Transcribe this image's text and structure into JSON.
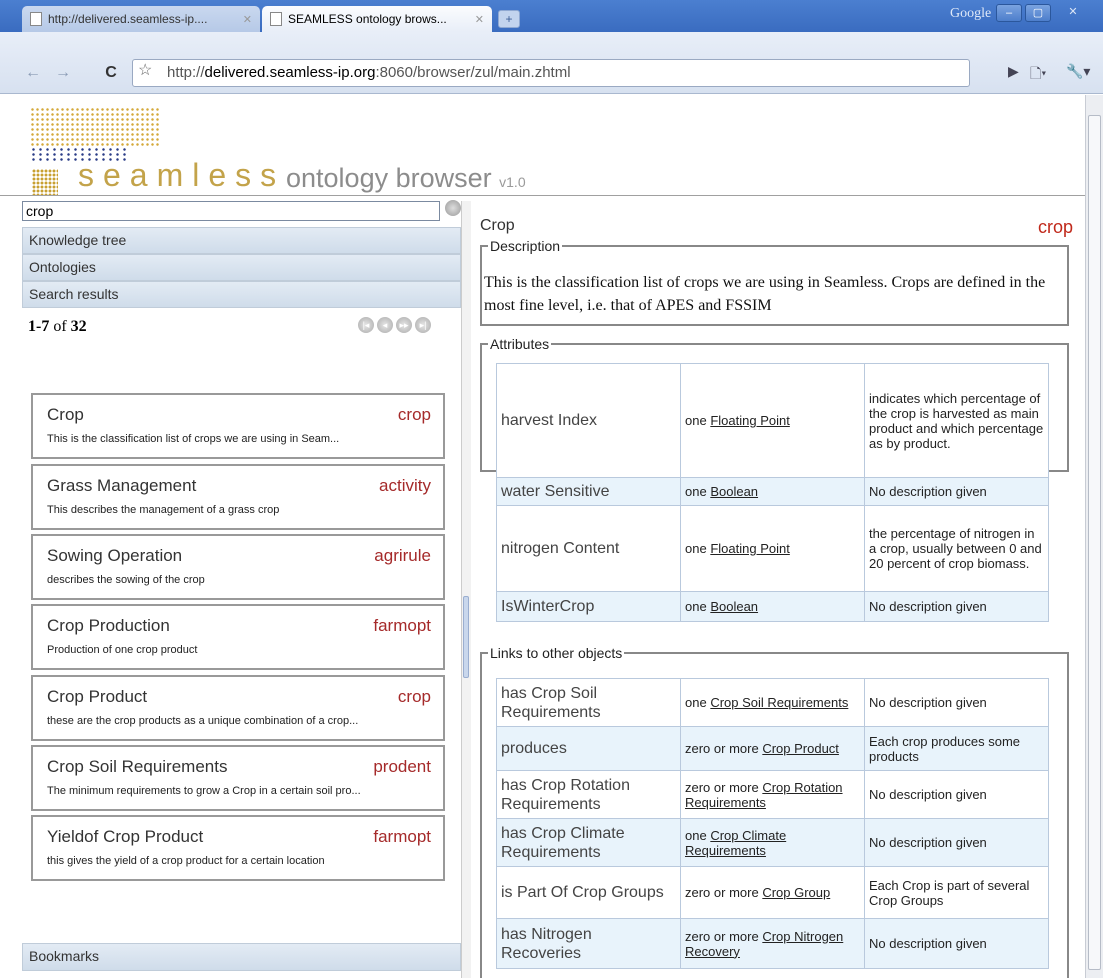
{
  "browser": {
    "tabs": [
      {
        "label": "http://delivered.seamless-ip....",
        "active": false
      },
      {
        "label": "SEAMLESS ontology brows...",
        "active": true
      }
    ],
    "brand": "Google",
    "url_prefix": "http://",
    "url_host": "delivered.seamless-ip.org",
    "url_rest": ":8060/browser/zul/main.zhtml"
  },
  "app": {
    "brand_word": "seamless",
    "brand_suffix": "ontology browser",
    "version": "v1.0"
  },
  "left": {
    "search_value": "crop",
    "sections": {
      "knowledge_tree": "Knowledge tree",
      "ontologies": "Ontologies",
      "search_results": "Search results",
      "bookmarks": "Bookmarks"
    },
    "count_range": "1-7",
    "count_of": "of",
    "count_total": "32",
    "results": [
      {
        "name": "Crop",
        "type": "crop",
        "desc": "This is the classification list of crops we are using in Seam..."
      },
      {
        "name": "Grass Management",
        "type": "activity",
        "desc": "This describes the management of a grass crop"
      },
      {
        "name": "Sowing Operation",
        "type": "agrirule",
        "desc": "describes the sowing of the crop"
      },
      {
        "name": "Crop Production",
        "type": "farmopt",
        "desc": "Production of one crop product"
      },
      {
        "name": "Crop Product",
        "type": "crop",
        "desc": "these are the crop products as a unique combination of a crop..."
      },
      {
        "name": "Crop Soil Requirements",
        "type": "prodent",
        "desc": "The minimum requirements to grow a Crop in a certain soil pro..."
      },
      {
        "name": "Yieldof Crop Product",
        "type": "farmopt",
        "desc": "this gives the yield of a crop product for a certain location"
      }
    ]
  },
  "detail": {
    "title": "Crop",
    "type": "crop",
    "description_legend": "Description",
    "description": "This is the classification list of crops we are using in Seamless. Crops are defined in the most fine level, i.e. that of APES and FSSIM",
    "attributes_legend": "Attributes",
    "attributes": [
      {
        "name": "harvest Index",
        "card": "one",
        "link": "Floating Point",
        "desc": "indicates which percentage of the crop is harvested as main product and which percentage as by product."
      },
      {
        "name": "water Sensitive",
        "card": "one",
        "link": "Boolean",
        "desc": "No description given"
      },
      {
        "name": "nitrogen Content",
        "card": "one",
        "link": "Floating Point",
        "desc": "the percentage of nitrogen in a crop, usually between 0 and 20 percent of crop biomass."
      },
      {
        "name": "IsWinterCrop",
        "card": "one",
        "link": "Boolean",
        "desc": "No description given"
      }
    ],
    "links_legend": "Links to other objects",
    "links": [
      {
        "name": "has Crop Soil Requirements",
        "card": "one",
        "link": "Crop Soil Requirements",
        "desc": "No description given"
      },
      {
        "name": "produces",
        "card": "zero or more",
        "link": "Crop Product",
        "desc": "Each crop produces some products"
      },
      {
        "name": "has Crop Rotation Requirements",
        "card": "zero or more",
        "link": "Crop Rotation Requirements",
        "desc": "No description given"
      },
      {
        "name": "has Crop Climate Requirements",
        "card": "one",
        "link": "Crop Climate Requirements",
        "desc": "No description given"
      },
      {
        "name": "is Part Of Crop Groups",
        "card": "zero or more",
        "link": "Crop Group",
        "desc": "Each Crop is part of several Crop Groups"
      },
      {
        "name": "has Nitrogen Recoveries",
        "card": "zero or more",
        "link": "Crop Nitrogen Recovery",
        "desc": "No description given"
      }
    ]
  }
}
